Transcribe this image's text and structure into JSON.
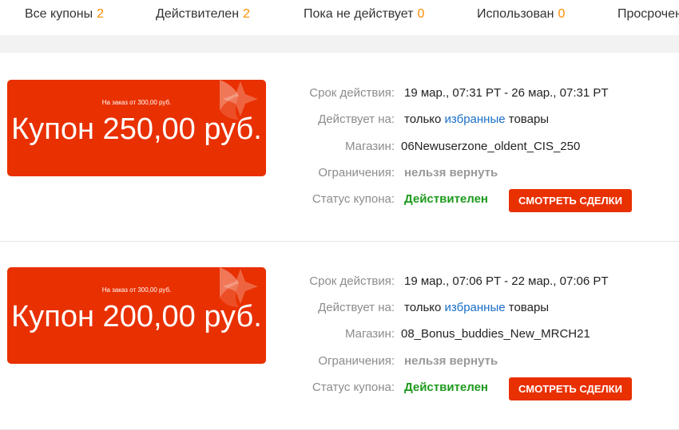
{
  "tabs": [
    {
      "label": "Все купоны",
      "count": "2"
    },
    {
      "label": "Действителен",
      "count": "2"
    },
    {
      "label": "Пока не действует",
      "count": "0"
    },
    {
      "label": "Использован",
      "count": "0"
    },
    {
      "label": "Просрочен",
      "count": ""
    }
  ],
  "labels": {
    "validity": "Срок действия:",
    "applies": "Действует на:",
    "shop": "Магазин:",
    "limits": "Ограничения:",
    "status": "Статус купона:"
  },
  "coupons": [
    {
      "min_order": "На заказ от 300,00 руб.",
      "amount": "Купон 250,00 руб.",
      "validity": "19 мар., 07:31 PT - 26 мар., 07:31 PT",
      "applies_pre": "только",
      "applies_link": "избранные",
      "applies_post": "товары",
      "shop": "06Newuserzone_oldent_CIS_250",
      "limits": "нельзя вернуть",
      "status": "Действителен",
      "button": "СМОТРЕТЬ СДЕЛКИ"
    },
    {
      "min_order": "На заказ от 300,00 руб.",
      "amount": "Купон 200,00 руб.",
      "validity": "19 мар., 07:06 PT - 22 мар., 07:06 PT",
      "applies_pre": "только",
      "applies_link": "избранные",
      "applies_post": "товары",
      "shop": "08_Bonus_buddies_New_MRCH21",
      "limits": "нельзя вернуть",
      "status": "Действителен",
      "button": "СМОТРЕТЬ СДЕЛКИ"
    }
  ]
}
